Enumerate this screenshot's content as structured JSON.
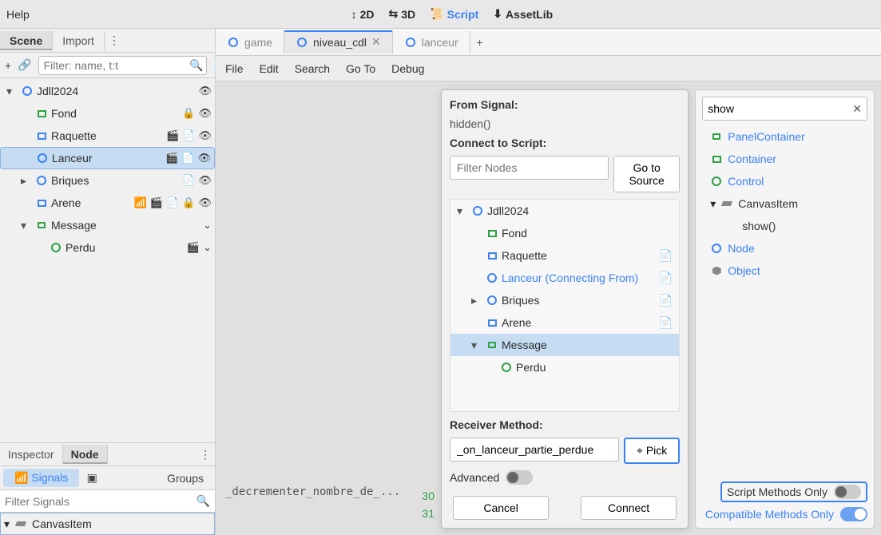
{
  "topbar": {
    "help": "Help",
    "views": {
      "2d": "2D",
      "3d": "3D",
      "script": "Script",
      "assetlib": "AssetLib"
    }
  },
  "left_tabs": {
    "scene": "Scene",
    "import": "Import"
  },
  "scene": {
    "filter_placeholder": "Filter: name, t:t",
    "nodes": [
      {
        "label": "Jdll2024",
        "icon": "node",
        "indent": 0,
        "chev": "▾",
        "ricons": [
          "eye"
        ]
      },
      {
        "label": "Fond",
        "icon": "tex",
        "indent": 1,
        "ricons": [
          "lock",
          "eye"
        ]
      },
      {
        "label": "Raquette",
        "icon": "rect",
        "indent": 1,
        "ricons": [
          "clapper",
          "script",
          "eye"
        ]
      },
      {
        "label": "Lanceur",
        "icon": "node",
        "indent": 1,
        "sel": true,
        "ricons": [
          "clapper",
          "script",
          "eye"
        ]
      },
      {
        "label": "Briques",
        "icon": "node",
        "indent": 1,
        "chev": "▸",
        "ricons": [
          "script",
          "eye"
        ]
      },
      {
        "label": "Arene",
        "icon": "rect",
        "indent": 1,
        "ricons": [
          "rss",
          "clapper",
          "script",
          "lock",
          "eye"
        ]
      },
      {
        "label": "Message",
        "icon": "panel",
        "indent": 1,
        "chev": "▾",
        "ricons": [
          "chev"
        ]
      },
      {
        "label": "Perdu",
        "icon": "node-g",
        "indent": 2,
        "ricons": [
          "clapper",
          "chev"
        ]
      }
    ]
  },
  "inspector_tabs": {
    "inspector": "Inspector",
    "node": "Node"
  },
  "signals": {
    "tab": "Signals",
    "groups": "Groups",
    "filter_placeholder": "Filter Signals",
    "canvas_item": "CanvasItem"
  },
  "editor_tabs": {
    "game": "game",
    "niveau": "niveau_cdl",
    "lanceur": "lanceur"
  },
  "editor_menu": [
    "File",
    "Edit",
    "Search",
    "Go To",
    "Debug"
  ],
  "code": {
    "fn": "_decrementer_nombre_de_...",
    "lines": [
      "30",
      "31"
    ]
  },
  "dialog": {
    "from_signal_label": "From Signal:",
    "from_signal_value": "hidden()",
    "connect_label": "Connect to Script:",
    "filter_placeholder": "Filter Nodes",
    "go_to_source": "Go to Source",
    "tree": [
      {
        "label": "Jdll2024",
        "icon": "node",
        "indent": 0,
        "chev": "▾"
      },
      {
        "label": "Fond",
        "icon": "tex",
        "indent": 1
      },
      {
        "label": "Raquette",
        "icon": "rect",
        "indent": 1,
        "script": true
      },
      {
        "label": "Lanceur (Connecting From)",
        "icon": "node",
        "indent": 1,
        "link": true,
        "script": true
      },
      {
        "label": "Briques",
        "icon": "node",
        "indent": 1,
        "chev": "▸",
        "script": true
      },
      {
        "label": "Arene",
        "icon": "rect",
        "indent": 1,
        "script": true
      },
      {
        "label": "Message",
        "icon": "panel",
        "indent": 1,
        "chev": "▾",
        "sel": true
      },
      {
        "label": "Perdu",
        "icon": "node-g",
        "indent": 2
      }
    ],
    "receiver_label": "Receiver Method:",
    "receiver_value": "_on_lanceur_partie_perdue",
    "pick": "Pick",
    "advanced": "Advanced",
    "cancel": "Cancel",
    "connect": "Connect"
  },
  "methods": {
    "search": "show",
    "list": [
      {
        "label": "PanelContainer",
        "icon": "panel",
        "indent": 0,
        "lnk": true
      },
      {
        "label": "Container",
        "icon": "rect-g",
        "indent": 0,
        "lnk": true
      },
      {
        "label": "Control",
        "icon": "node-g",
        "indent": 0,
        "lnk": true
      },
      {
        "label": "CanvasItem",
        "icon": "canvas",
        "indent": 0,
        "chev": "▾",
        "plain": true
      },
      {
        "label": "show()",
        "icon": "",
        "indent": 1,
        "plain": true
      },
      {
        "label": "Node",
        "icon": "node",
        "indent": 0,
        "lnk": true
      },
      {
        "label": "Object",
        "icon": "obj",
        "indent": 0,
        "lnk": true
      }
    ],
    "script_only": "Script Methods Only",
    "compatible_only": "Compatible Methods Only"
  }
}
